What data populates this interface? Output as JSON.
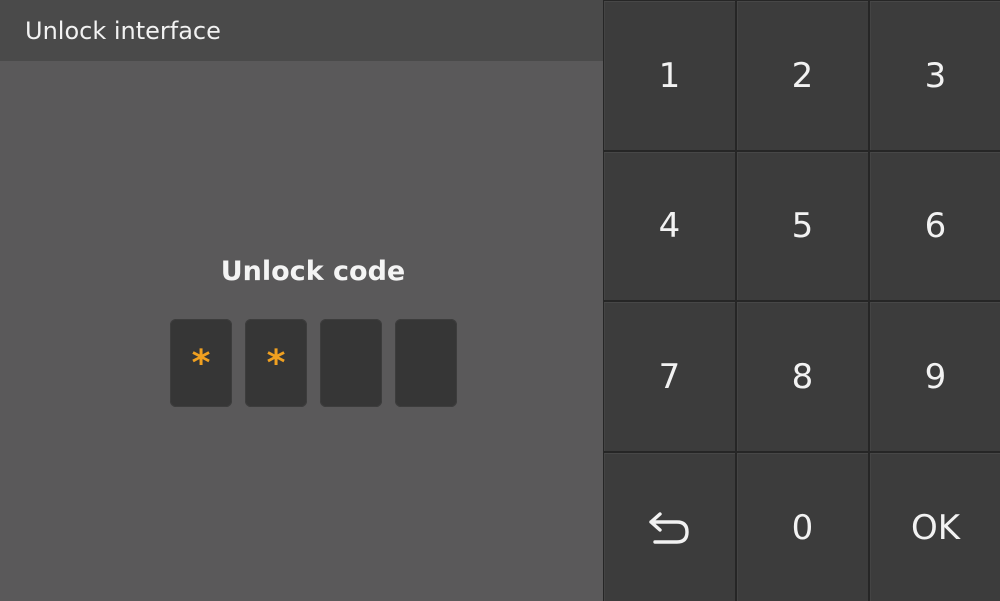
{
  "header": {
    "title": "Unlock interface"
  },
  "code_entry": {
    "label": "Unlock code",
    "slots": [
      "*",
      "*",
      "",
      ""
    ]
  },
  "keypad": {
    "keys": [
      "1",
      "2",
      "3",
      "4",
      "5",
      "6",
      "7",
      "8",
      "9",
      "",
      "0",
      "OK"
    ],
    "back_icon": "return-arrow-icon"
  },
  "colors": {
    "panel_background": "#5a595a",
    "title_bar": "#4a4a4a",
    "key_background": "#3c3c3c",
    "masked_digit": "#f0a020",
    "text": "#f2f2f2"
  }
}
